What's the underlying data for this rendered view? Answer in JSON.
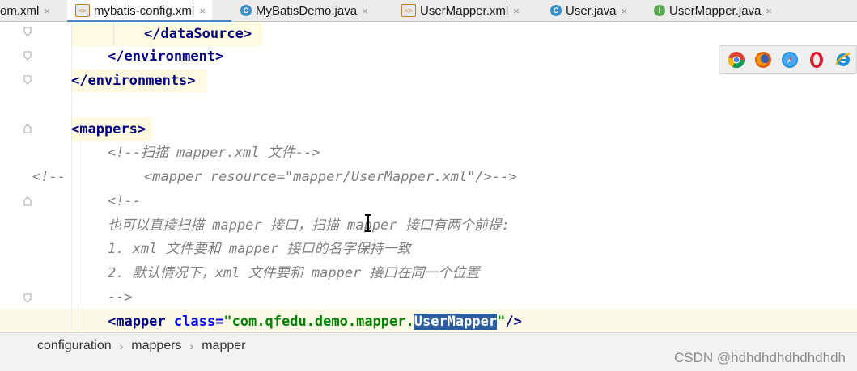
{
  "tabs": [
    {
      "label": "om.xml",
      "icon": "xml-file-icon",
      "active": false
    },
    {
      "label": "mybatis-config.xml",
      "icon": "xml-file-icon",
      "active": true
    },
    {
      "label": "MyBatisDemo.java",
      "icon": "java-class-icon",
      "active": false
    },
    {
      "label": "UserMapper.xml",
      "icon": "xml-file-icon",
      "active": false
    },
    {
      "label": "User.java",
      "icon": "java-class-icon",
      "active": false
    },
    {
      "label": "UserMapper.java",
      "icon": "java-interface-icon",
      "active": false
    }
  ],
  "close_glyph": "×",
  "code": {
    "l1": "</dataSource>",
    "l2": "</environment>",
    "l3": "</environments>",
    "l4": "<mappers>",
    "l5": "<!--扫描 mapper.xml 文件-->",
    "l6_gutter": "<!--",
    "l6": "<mapper resource=\"mapper/UserMapper.xml\"/>-->",
    "l7": "<!--",
    "l8": "也可以直接扫描 mapper 接口，扫描 mapper 接口有两个前提:",
    "l9": "1. xml 文件要和 mapper 接口的名字保持一致",
    "l10": "2. 默认情况下，xml 文件要和 mapper 接口在同一个位置",
    "l11": "-->",
    "l12_tag": "<mapper",
    "l12_attr": "class=",
    "l12_str_a": "\"com.qfedu.demo.mapper.",
    "l12_sel": "UserMapper",
    "l12_str_b": "\"",
    "l12_end": "/>"
  },
  "browsers": [
    "chrome-icon",
    "firefox-icon",
    "safari-icon",
    "opera-icon",
    "ie-icon"
  ],
  "breadcrumb": [
    "configuration",
    "mappers",
    "mapper"
  ],
  "breadcrumb_sep": "›",
  "watermark": "CSDN @hdhdhdhdhdhdhdh",
  "colors": {
    "tag": "#000080",
    "attr": "#0000ff",
    "string": "#008000",
    "comment": "#808080",
    "selection": "#2b5d9c"
  }
}
